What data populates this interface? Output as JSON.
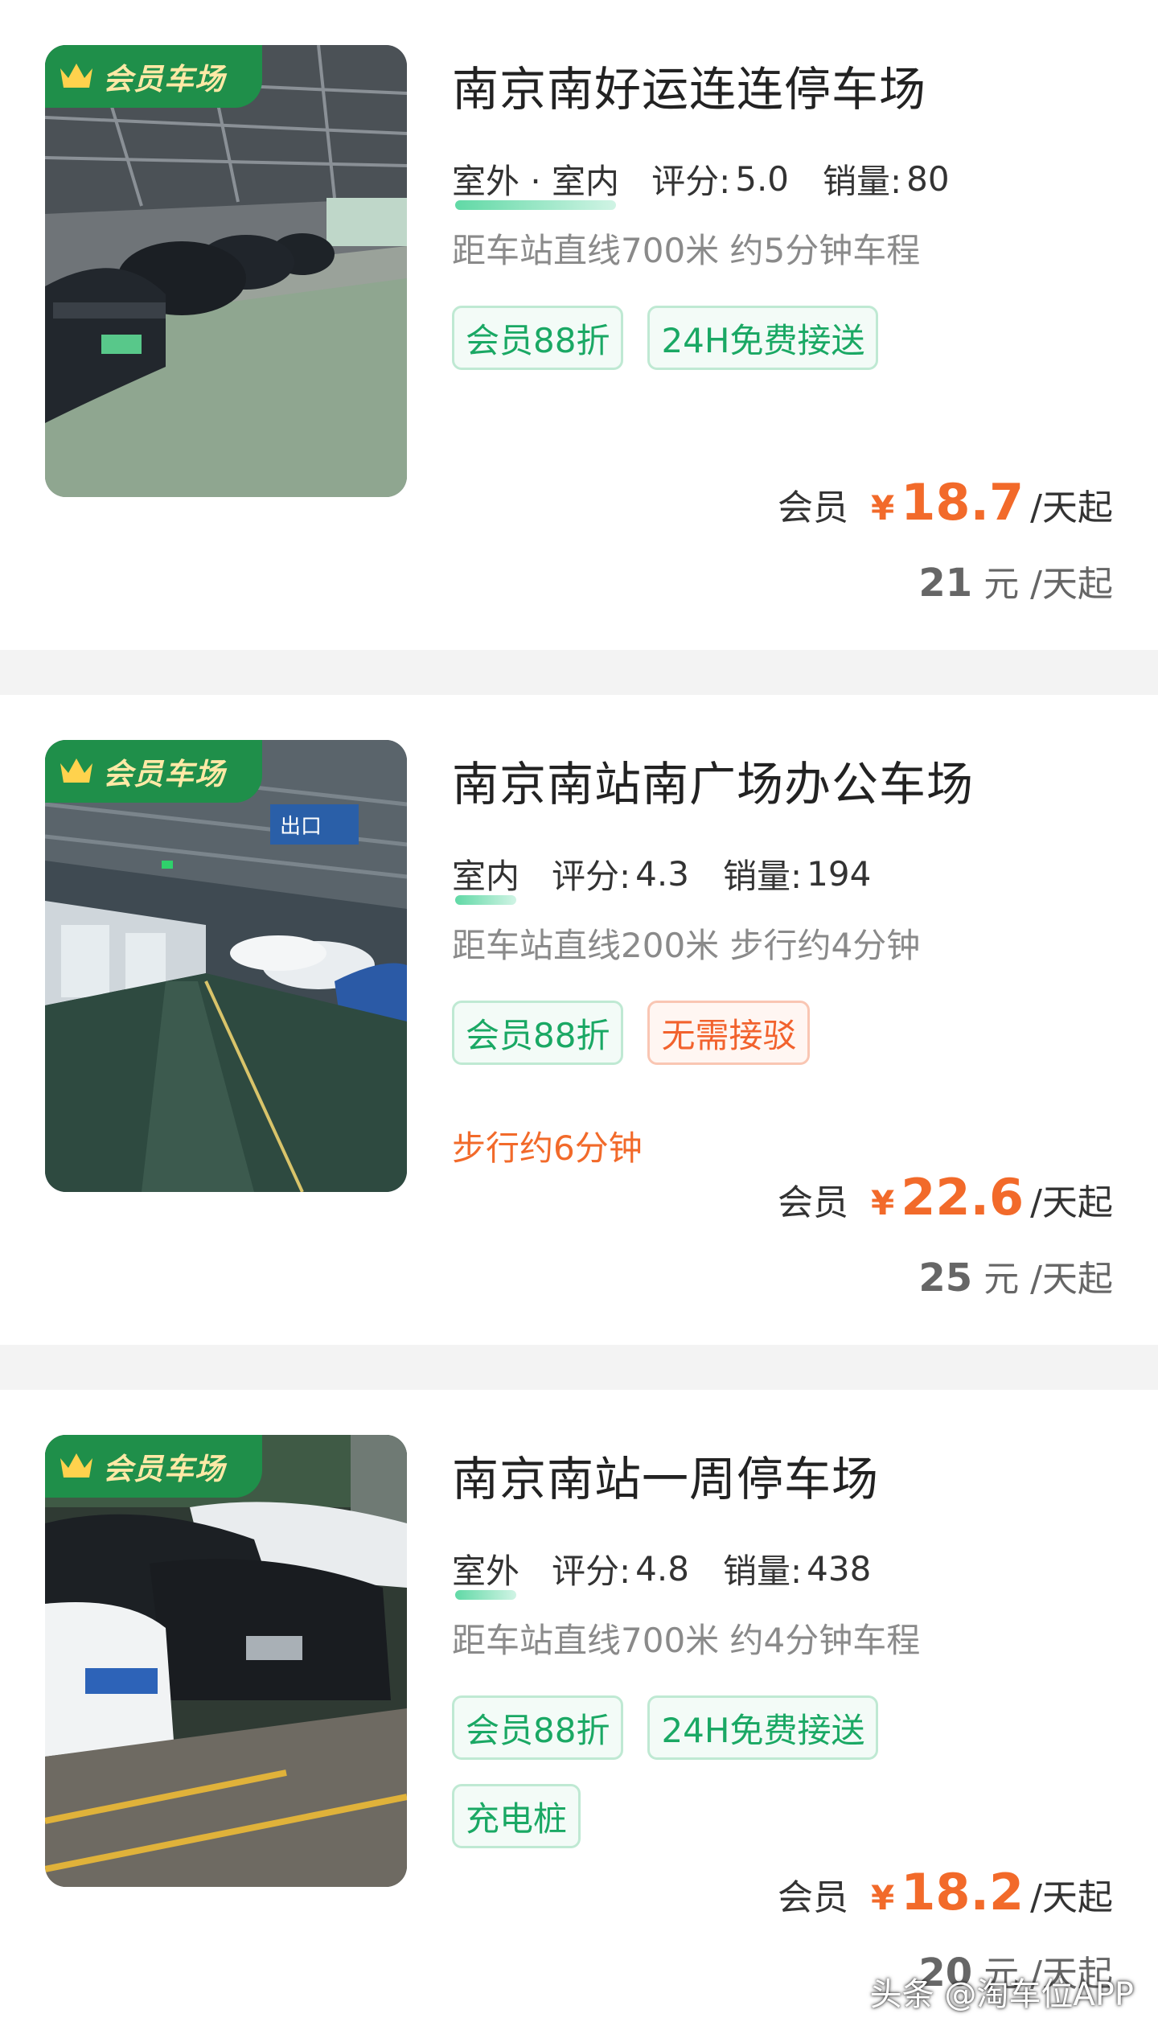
{
  "colors": {
    "accent_green": "#1aa864",
    "accent_orange": "#f26a2a",
    "badge_bg": "#1f8f4a",
    "badge_text": "#ffe9a6"
  },
  "listings": [
    {
      "badge": "会员车场",
      "title": "南京南好运连连停车场",
      "env": "室外 · 室内",
      "rating_label": "评分:",
      "rating": "5.0",
      "sales_label": "销量:",
      "sales": "80",
      "distance": "距车站直线700米 约5分钟车程",
      "tags": [
        {
          "text": "会员88折",
          "color": "green"
        },
        {
          "text": "24H免费接送",
          "color": "green"
        }
      ],
      "note": "",
      "member_label": "会员",
      "currency": "¥",
      "member_price": "18.7",
      "unit": "/天起",
      "orig_price": "21",
      "orig_unit": "元 /天起"
    },
    {
      "badge": "会员车场",
      "title": "南京南站南广场办公车场",
      "env": "室内",
      "rating_label": "评分:",
      "rating": "4.3",
      "sales_label": "销量:",
      "sales": "194",
      "distance": "距车站直线200米 步行约4分钟",
      "tags": [
        {
          "text": "会员88折",
          "color": "green"
        },
        {
          "text": "无需接驳",
          "color": "orange"
        }
      ],
      "note": "步行约6分钟",
      "member_label": "会员",
      "currency": "¥",
      "member_price": "22.6",
      "unit": "/天起",
      "orig_price": "25",
      "orig_unit": "元 /天起"
    },
    {
      "badge": "会员车场",
      "title": "南京南站一周停车场",
      "env": "室外",
      "rating_label": "评分:",
      "rating": "4.8",
      "sales_label": "销量:",
      "sales": "438",
      "distance": "距车站直线700米 约4分钟车程",
      "tags": [
        {
          "text": "会员88折",
          "color": "green"
        },
        {
          "text": "24H免费接送",
          "color": "green"
        },
        {
          "text": "充电桩",
          "color": "green"
        }
      ],
      "note": "",
      "member_label": "会员",
      "currency": "¥",
      "member_price": "18.2",
      "unit": "/天起",
      "orig_price": "20",
      "orig_unit": "元 /天起"
    }
  ],
  "photo_sign": "出口",
  "watermark": "头条 @淘车位APP"
}
